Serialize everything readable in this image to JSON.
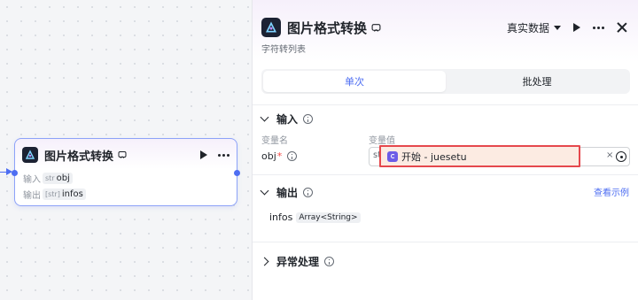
{
  "node": {
    "title": "图片格式转换",
    "input_label": "输入",
    "input_type": "str",
    "input_name": "obj",
    "output_label": "输出",
    "output_type": "[str]",
    "output_name": "infos"
  },
  "panel": {
    "title": "图片格式转换",
    "subtitle": "字符转列表",
    "data_mode": "真实数据",
    "tabs": [
      {
        "label": "单次",
        "active": true
      },
      {
        "label": "批处理",
        "active": false
      }
    ],
    "input_section": {
      "title": "输入",
      "col_name": "变量名",
      "col_value": "变量值",
      "param_name": "obj",
      "required_mark": "*",
      "value_prefix": "st",
      "ref_value": "开始 - juesetu"
    },
    "output_section": {
      "title": "输出",
      "example_link": "查看示例",
      "var_name": "infos",
      "var_type": "Array<String>"
    },
    "exception_section": {
      "title": "异常处理"
    }
  },
  "colors": {
    "accent": "#4e6ef2",
    "highlight_border": "#e5484d",
    "highlight_fill": "#fcebe2"
  }
}
